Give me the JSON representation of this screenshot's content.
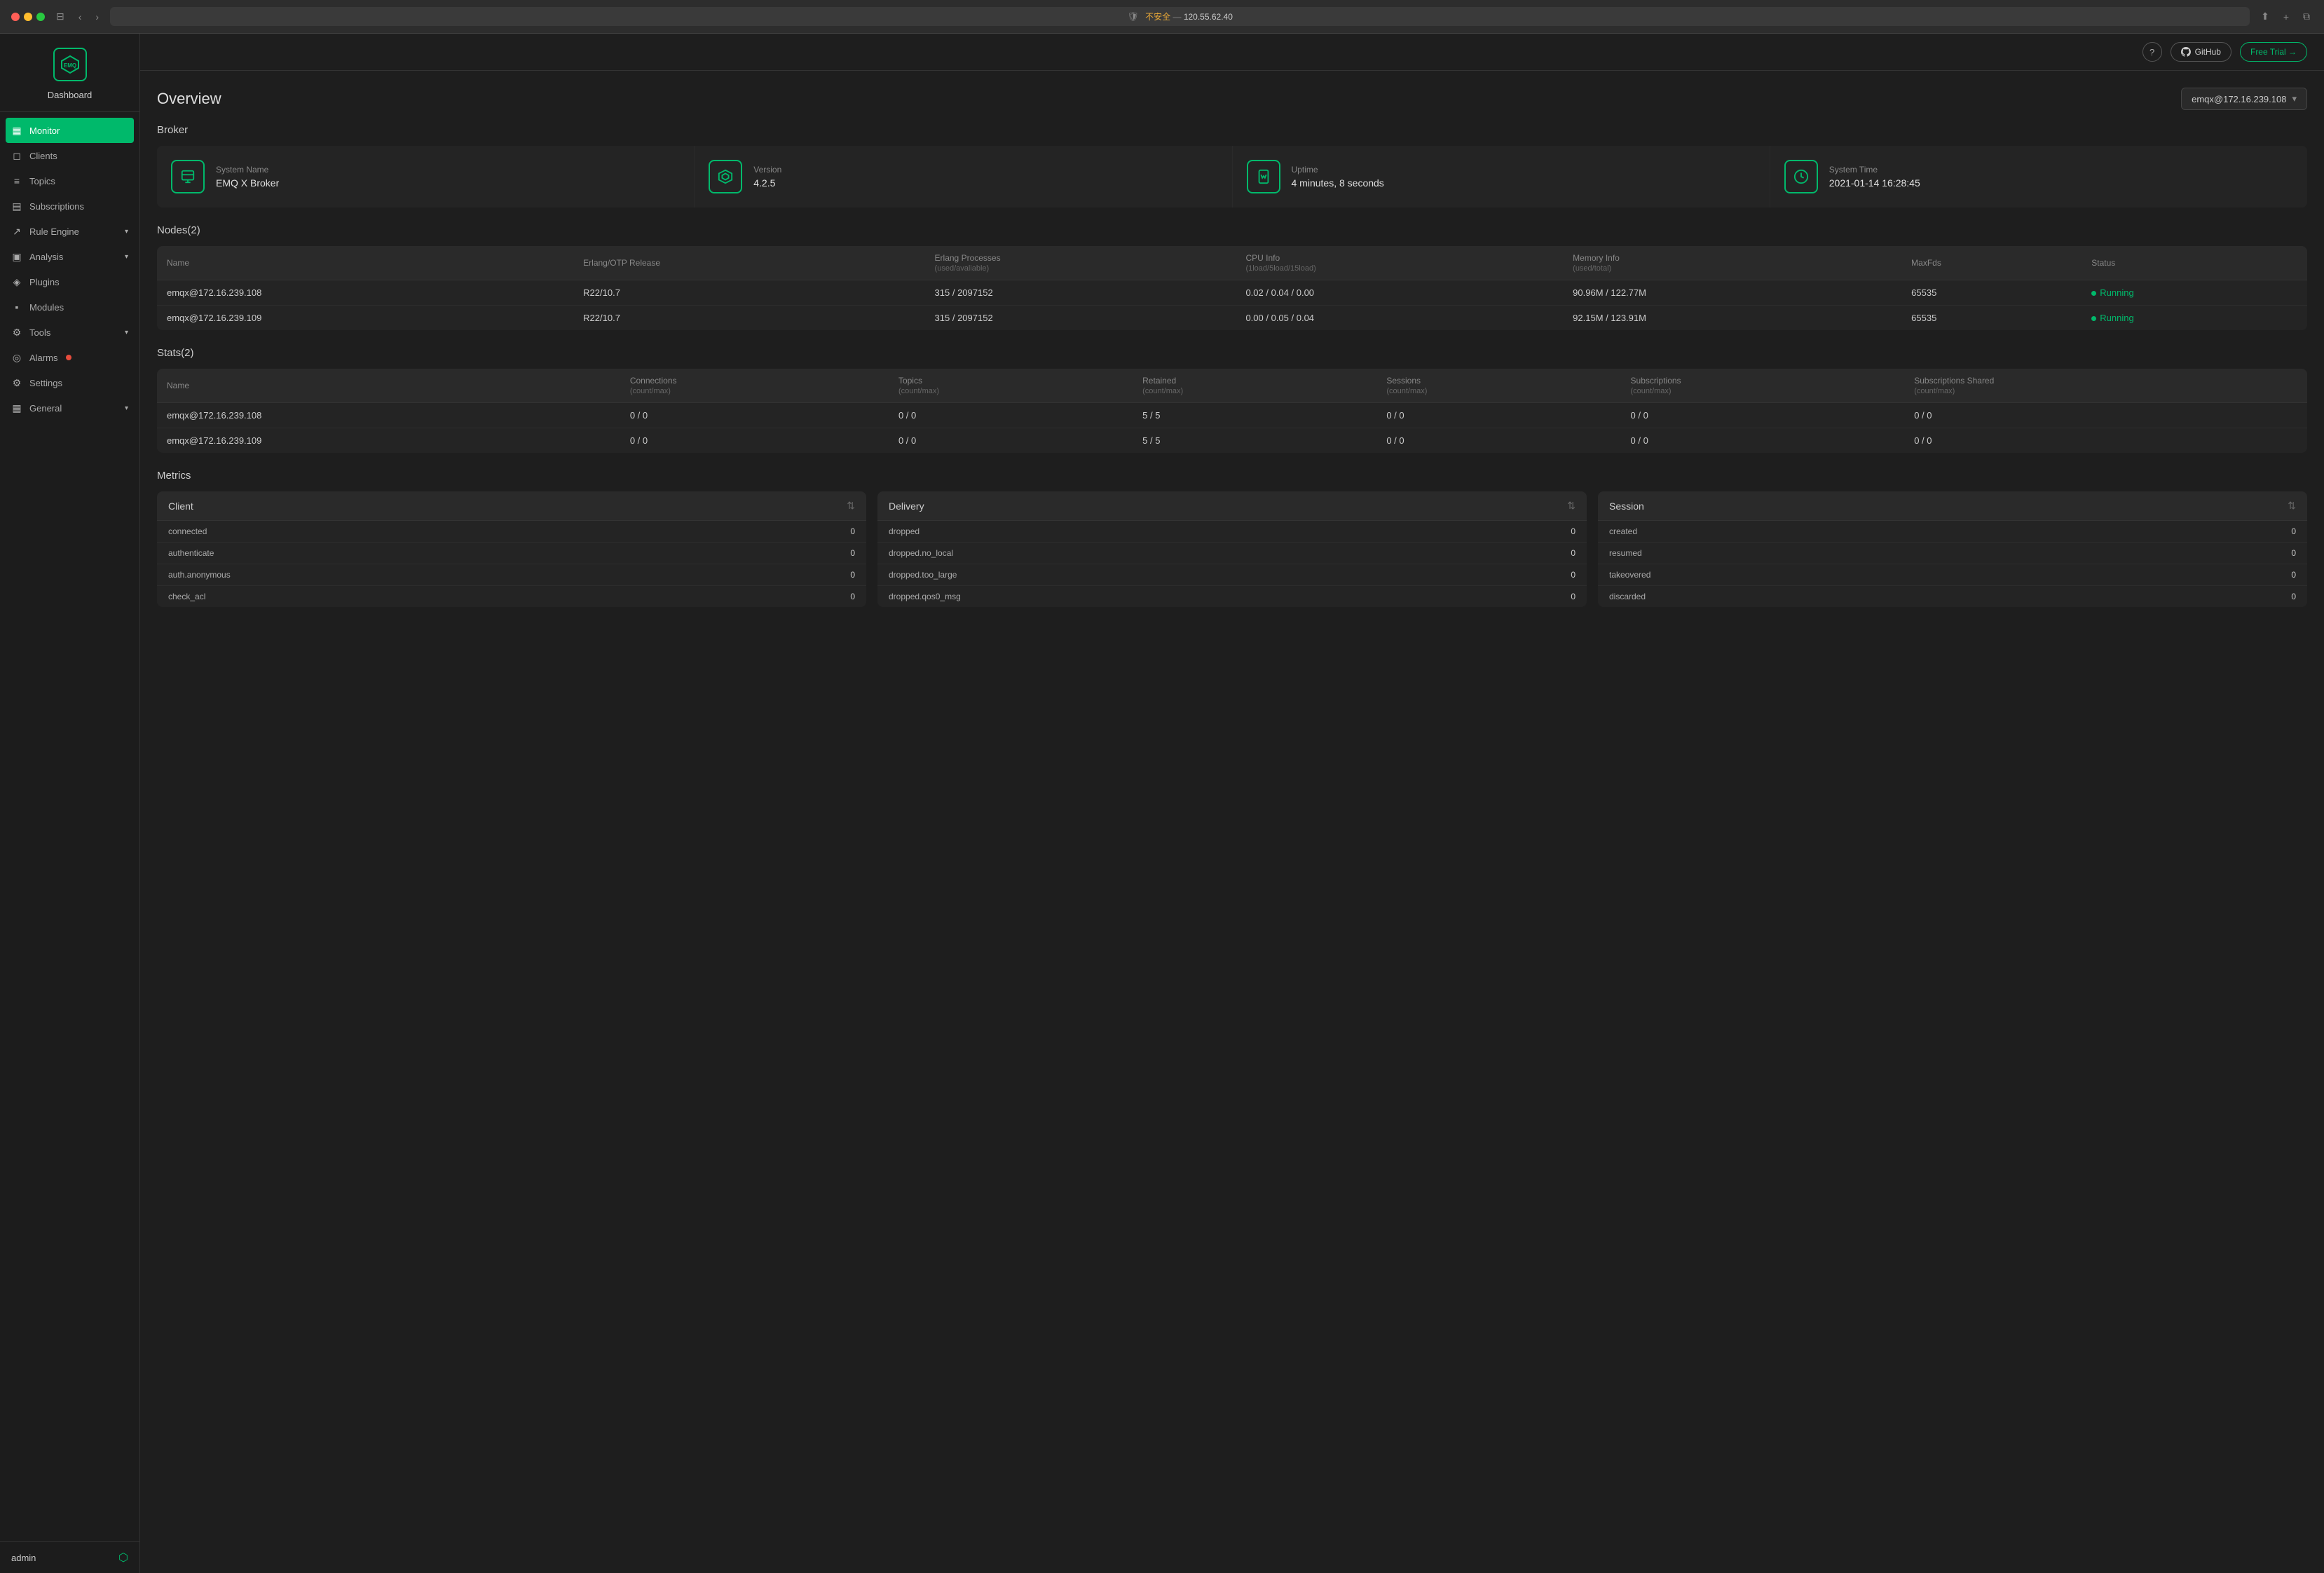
{
  "browser": {
    "address": "不安全 — 120.55.62.40",
    "address_insecure": "不安全",
    "address_domain": "120.55.62.40"
  },
  "header": {
    "help_label": "?",
    "github_label": "GitHub",
    "free_trial_label": "Free Trial →"
  },
  "sidebar": {
    "logo_text": "EMQ",
    "dashboard_label": "Dashboard",
    "nav_items": [
      {
        "id": "monitor",
        "label": "Monitor",
        "icon": "▦",
        "active": true
      },
      {
        "id": "clients",
        "label": "Clients",
        "icon": "◻"
      },
      {
        "id": "topics",
        "label": "Topics",
        "icon": "≡"
      },
      {
        "id": "subscriptions",
        "label": "Subscriptions",
        "icon": "▤"
      },
      {
        "id": "rule-engine",
        "label": "Rule Engine",
        "icon": "↗",
        "has_chevron": true
      },
      {
        "id": "analysis",
        "label": "Analysis",
        "icon": "▣",
        "has_chevron": true
      },
      {
        "id": "plugins",
        "label": "Plugins",
        "icon": "◈"
      },
      {
        "id": "modules",
        "label": "Modules",
        "icon": "▪"
      },
      {
        "id": "tools",
        "label": "Tools",
        "icon": "⚙",
        "has_chevron": true
      },
      {
        "id": "alarms",
        "label": "Alarms",
        "icon": "◎",
        "has_badge": true
      },
      {
        "id": "settings",
        "label": "Settings",
        "icon": "⚙"
      },
      {
        "id": "general",
        "label": "General",
        "icon": "▦",
        "has_chevron": true
      }
    ],
    "user": "admin",
    "logout_icon": "⬡"
  },
  "page": {
    "title": "Overview",
    "node_selector": "emqx@172.16.239.108"
  },
  "broker": {
    "section_title": "Broker",
    "cards": [
      {
        "id": "system-name",
        "label": "System Name",
        "value": "EMQ X Broker",
        "icon": "doc"
      },
      {
        "id": "version",
        "label": "Version",
        "value": "4.2.5",
        "icon": "layers"
      },
      {
        "id": "uptime",
        "label": "Uptime",
        "value": "4 minutes, 8 seconds",
        "icon": "hourglass"
      },
      {
        "id": "system-time",
        "label": "System Time",
        "value": "2021-01-14 16:28:45",
        "icon": "clock"
      }
    ]
  },
  "nodes": {
    "section_title": "Nodes(2)",
    "columns": [
      {
        "id": "name",
        "label": "Name",
        "sub": ""
      },
      {
        "id": "erlang-otp",
        "label": "Erlang/OTP Release",
        "sub": ""
      },
      {
        "id": "erlang-proc",
        "label": "Erlang Processes",
        "sub": "(used/avaliable)"
      },
      {
        "id": "cpu-info",
        "label": "CPU Info",
        "sub": "(1load/5load/15load)"
      },
      {
        "id": "memory-info",
        "label": "Memory Info",
        "sub": "(used/total)"
      },
      {
        "id": "maxfds",
        "label": "MaxFds",
        "sub": ""
      },
      {
        "id": "status",
        "label": "Status",
        "sub": ""
      }
    ],
    "rows": [
      {
        "name": "emqx@172.16.239.108",
        "erlang_otp": "R22/10.7",
        "erlang_proc": "315 / 2097152",
        "cpu_info": "0.02 / 0.04 / 0.00",
        "memory_info": "90.96M / 122.77M",
        "maxfds": "65535",
        "status": "Running"
      },
      {
        "name": "emqx@172.16.239.109",
        "erlang_otp": "R22/10.7",
        "erlang_proc": "315 / 2097152",
        "cpu_info": "0.00 / 0.05 / 0.04",
        "memory_info": "92.15M / 123.91M",
        "maxfds": "65535",
        "status": "Running"
      }
    ]
  },
  "stats": {
    "section_title": "Stats(2)",
    "columns": [
      {
        "id": "name",
        "label": "Name",
        "sub": ""
      },
      {
        "id": "connections",
        "label": "Connections",
        "sub": "(count/max)"
      },
      {
        "id": "topics",
        "label": "Topics",
        "sub": "(count/max)"
      },
      {
        "id": "retained",
        "label": "Retained",
        "sub": "(count/max)"
      },
      {
        "id": "sessions",
        "label": "Sessions",
        "sub": "(count/max)"
      },
      {
        "id": "subscriptions",
        "label": "Subscriptions",
        "sub": "(count/max)"
      },
      {
        "id": "subscriptions-shared",
        "label": "Subscriptions Shared",
        "sub": "(count/max)"
      }
    ],
    "rows": [
      {
        "name": "emqx@172.16.239.108",
        "connections": "0 / 0",
        "topics": "0 / 0",
        "retained": "5 / 5",
        "sessions": "0 / 0",
        "subscriptions": "0 / 0",
        "subscriptions_shared": "0 / 0"
      },
      {
        "name": "emqx@172.16.239.109",
        "connections": "0 / 0",
        "topics": "0 / 0",
        "retained": "5 / 5",
        "sessions": "0 / 0",
        "subscriptions": "0 / 0",
        "subscriptions_shared": "0 / 0"
      }
    ]
  },
  "metrics": {
    "section_title": "Metrics",
    "cards": [
      {
        "id": "client",
        "title": "Client",
        "rows": [
          {
            "label": "connected",
            "value": "0"
          },
          {
            "label": "authenticate",
            "value": "0"
          },
          {
            "label": "auth.anonymous",
            "value": "0"
          },
          {
            "label": "check_acl",
            "value": "0"
          }
        ]
      },
      {
        "id": "delivery",
        "title": "Delivery",
        "rows": [
          {
            "label": "dropped",
            "value": "0"
          },
          {
            "label": "dropped.no_local",
            "value": "0"
          },
          {
            "label": "dropped.too_large",
            "value": "0"
          },
          {
            "label": "dropped.qos0_msg",
            "value": "0"
          }
        ]
      },
      {
        "id": "session",
        "title": "Session",
        "rows": [
          {
            "label": "created",
            "value": "0"
          },
          {
            "label": "resumed",
            "value": "0"
          },
          {
            "label": "takeovered",
            "value": "0"
          },
          {
            "label": "discarded",
            "value": "0"
          }
        ]
      }
    ]
  },
  "colors": {
    "accent": "#00b96b",
    "danger": "#e74c3c",
    "bg_dark": "#1c1c1c",
    "bg_main": "#1e1e1e",
    "bg_card": "#242424"
  }
}
